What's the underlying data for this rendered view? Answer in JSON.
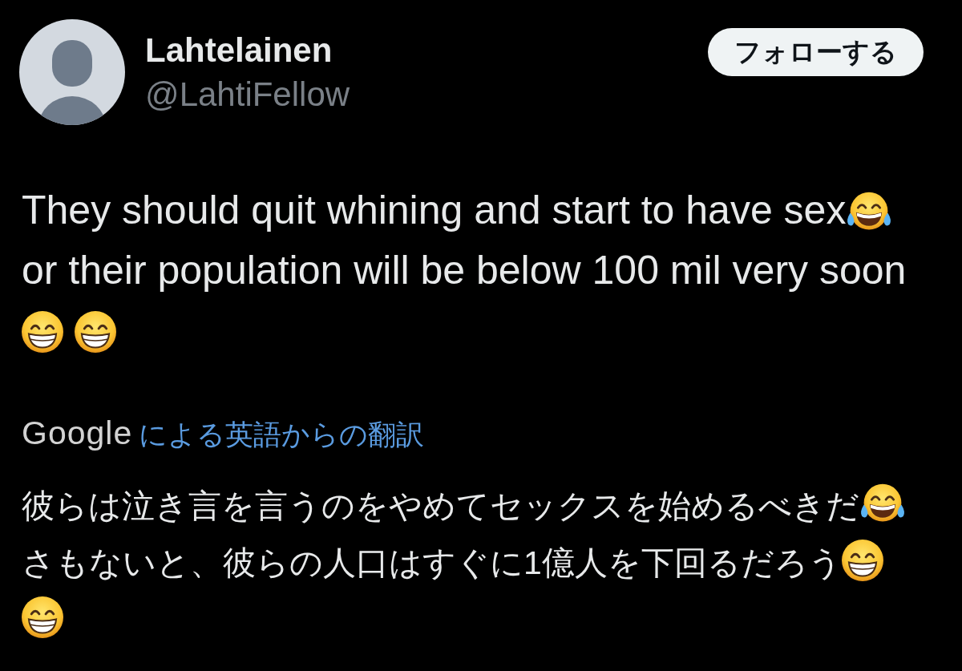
{
  "post": {
    "author": {
      "name": "Lahtelainen",
      "handle": "@LahtiFellow"
    },
    "follow_button": {
      "label": "フォローする"
    },
    "body": [
      {
        "kind": "text",
        "text": "They should quit whining and start to have sex"
      },
      {
        "kind": "joy"
      },
      {
        "kind": "text",
        "text": "or their population will be below 100 mil very soon"
      },
      {
        "kind": "grin"
      },
      {
        "kind": "grin"
      }
    ],
    "translation": {
      "provider": "Google",
      "link": "による英語からの翻訳",
      "body": [
        {
          "kind": "text",
          "text": "彼らは泣き言を言うのをやめてセックスを始めるべきだ"
        },
        {
          "kind": "joy"
        },
        {
          "kind": "text",
          "text": "さもないと、彼らの人口はすぐに1億人を下回るだろう"
        },
        {
          "kind": "grin"
        },
        {
          "kind": "grin"
        }
      ]
    }
  }
}
